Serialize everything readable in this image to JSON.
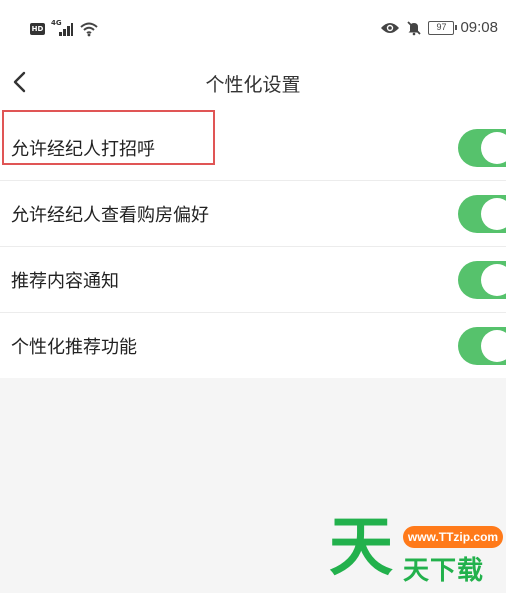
{
  "status_bar": {
    "hd_badge": "HD",
    "network_type": "4G",
    "battery_level": "97",
    "time": "09:08",
    "icons": [
      "hd-icon",
      "signal-icon",
      "wifi-icon",
      "eye-icon",
      "mute-icon",
      "battery-icon"
    ]
  },
  "nav": {
    "title": "个性化设置",
    "back_icon": "chevron-left-icon"
  },
  "settings": {
    "items": [
      {
        "label": "允许经纪人打招呼",
        "enabled": true
      },
      {
        "label": "允许经纪人查看购房偏好",
        "enabled": true
      },
      {
        "label": "推荐内容通知",
        "enabled": true
      },
      {
        "label": "个性化推荐功能",
        "enabled": true
      }
    ]
  },
  "watermark": {
    "big_char": "天",
    "url": "www.TTzip.com",
    "text": "天下载"
  },
  "colors": {
    "toggle_on": "#56c26c",
    "highlight_border": "#e05555",
    "watermark_green": "#22b14c",
    "watermark_orange": "#ff7a1a"
  }
}
